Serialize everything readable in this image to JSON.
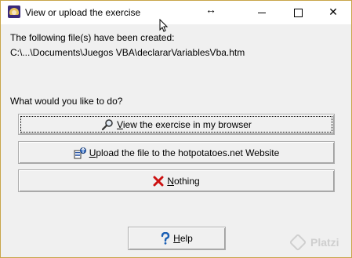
{
  "window": {
    "title": "View or upload the exercise",
    "resize_glyph": "↔",
    "controls": {
      "minimize_icon": "minimize-icon",
      "maximize_icon": "maximize-icon",
      "close_glyph": "✕"
    }
  },
  "message": {
    "line1": "The following file(s) have been created:",
    "path": "C:\\...\\Documents\\Juegos VBA\\declararVariablesVba.htm",
    "prompt": "What would you like to do?"
  },
  "actions": {
    "view": {
      "hotkey": "V",
      "rest": "iew the exercise in my browser",
      "icon": "magnifier-icon"
    },
    "upload": {
      "hotkey": "U",
      "rest": "pload the file to the hotpotatoes.net Website",
      "icon": "upload-icon"
    },
    "nothing": {
      "hotkey": "N",
      "rest": "othing",
      "icon": "red-x-icon"
    },
    "help": {
      "hotkey": "H",
      "rest": "elp",
      "icon": "question-icon"
    }
  },
  "watermark": {
    "text": "Platzi"
  },
  "colors": {
    "window_border": "#c9a64a",
    "background": "#f0f0f0",
    "red_x": "#cc1111",
    "help_blue": "#1a5fb4"
  }
}
